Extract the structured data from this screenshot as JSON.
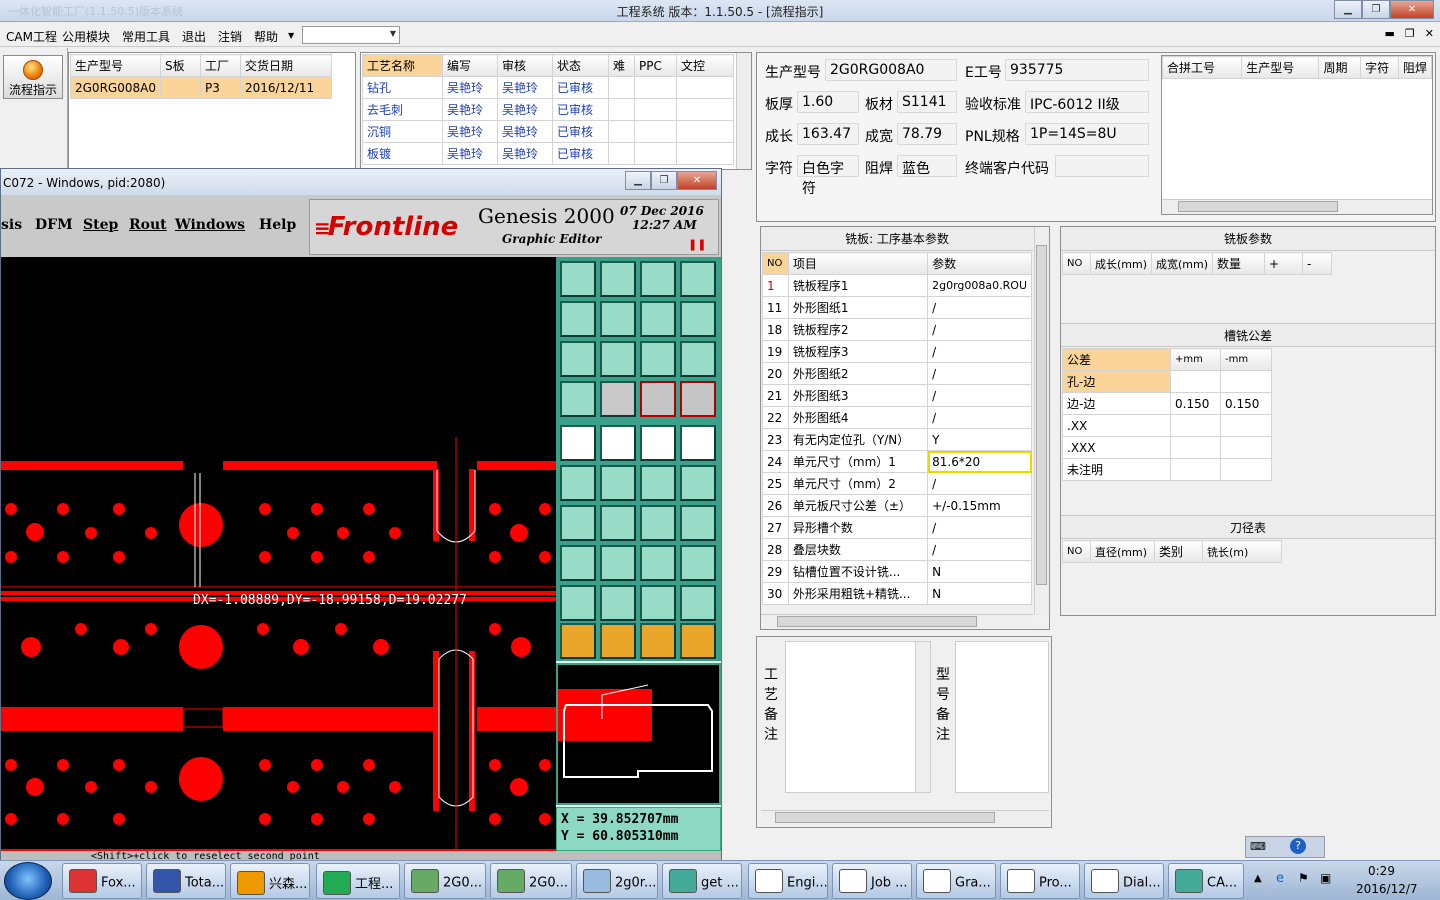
{
  "window": {
    "title": "工程系统  版本：1.1.50.5 - [流程指示]",
    "ghost": "一体化智能工厂(1.1.50.5)版本系统"
  },
  "menu": [
    "CAM工程",
    "公用模块",
    "常用工具",
    "退出",
    "注销",
    "帮助"
  ],
  "flow_button": "流程指示",
  "order_table": {
    "headers": [
      "生产型号",
      "S板",
      "工厂",
      "交货日期"
    ],
    "row": [
      "2G0RG008A0",
      "",
      "P3",
      "2016/12/11"
    ]
  },
  "process_table": {
    "headers": [
      "工艺名称",
      "编写",
      "审核",
      "状态",
      "难",
      "PPC",
      "文控"
    ],
    "rows": [
      [
        "钻孔",
        "吴艳玲",
        "吴艳玲",
        "已审核"
      ],
      [
        "去毛刺",
        "吴艳玲",
        "吴艳玲",
        "已审核"
      ],
      [
        "沉铜",
        "吴艳玲",
        "吴艳玲",
        "已审核"
      ],
      [
        "板镀",
        "吴艳玲",
        "吴艳玲",
        "已审核"
      ]
    ]
  },
  "genesis": {
    "title": "C072 - Windows, pid:2080)",
    "menu": [
      "sis",
      "DFM",
      "Step",
      "Rout",
      "Windows",
      "Help"
    ],
    "brand": "Frontline",
    "product": "Genesis 2000",
    "date": "07 Dec 2016",
    "time": "12:27 AM",
    "subtitle": "Graphic Editor",
    "measure": "DX=-1.08889,DY=-18.99158,D=19.02277",
    "x": "X =  39.852707mm",
    "y": "Y =  60.805310mm",
    "status": "<Shift>+click to reselect second point"
  },
  "info": {
    "fields": [
      {
        "label": "生产型号",
        "value": "2G0RG008A0"
      },
      {
        "label": "E工号",
        "value": "935775"
      },
      {
        "label": "板厚",
        "value": "1.60"
      },
      {
        "label": "板材",
        "value": "S1141"
      },
      {
        "label": "验收标准",
        "value": "IPC-6012 II级"
      },
      {
        "label": "成长",
        "value": "163.47"
      },
      {
        "label": "成宽",
        "value": "78.79"
      },
      {
        "label": "PNL规格",
        "value": "1P=14S=8U"
      },
      {
        "label": "字符",
        "value": "白色字符"
      },
      {
        "label": "阻焊",
        "value": "蓝色"
      },
      {
        "label": "终端客户代码",
        "value": ""
      }
    ]
  },
  "merge_table": {
    "headers": [
      "合拼工号",
      "生产型号",
      "周期",
      "字符",
      "阻焊"
    ]
  },
  "params": {
    "title": "铣板: 工序基本参数",
    "headers": [
      "NO",
      "项目",
      "参数"
    ],
    "rows": [
      [
        "1",
        "铣板程序1",
        "2g0rg008a0.ROU"
      ],
      [
        "11",
        "外形图纸1",
        "/"
      ],
      [
        "18",
        "铣板程序2",
        "/"
      ],
      [
        "19",
        "铣板程序3",
        "/"
      ],
      [
        "20",
        "外形图纸2",
        "/"
      ],
      [
        "21",
        "外形图纸3",
        "/"
      ],
      [
        "22",
        "外形图纸4",
        "/"
      ],
      [
        "23",
        "有无内定位孔（Y/N）",
        "Y"
      ],
      [
        "24",
        "单元尺寸（mm）1",
        "81.6*20"
      ],
      [
        "25",
        "单元尺寸（mm）2",
        "/"
      ],
      [
        "26",
        "单元板尺寸公差（±）",
        "+/-0.15mm"
      ],
      [
        "27",
        "异形槽个数",
        "/"
      ],
      [
        "28",
        "叠层块数",
        "/"
      ],
      [
        "29",
        "钻槽位置不设计铣...",
        "N"
      ],
      [
        "30",
        "外形采用粗铣+精铣...",
        "N"
      ]
    ]
  },
  "mill_params": {
    "title": "铣板参数",
    "headers": [
      "NO",
      "成长(mm)",
      "成宽(mm)",
      "数量",
      "+",
      "-"
    ]
  },
  "slot_tol": {
    "title": "槽铣公差",
    "headers": [
      "公差",
      "+mm",
      "-mm"
    ],
    "rows": [
      [
        "孔-边",
        "",
        ""
      ],
      [
        "边-边",
        "0.150",
        "0.150"
      ],
      [
        ".XX",
        "",
        ""
      ],
      [
        ".XXX",
        "",
        ""
      ],
      [
        "未注明",
        "",
        ""
      ]
    ]
  },
  "tools": {
    "title": "刀径表",
    "headers": [
      "NO",
      "直径(mm)",
      "类别",
      "铣长(m)"
    ]
  },
  "notes": {
    "left": [
      "工",
      "艺",
      "备",
      "注"
    ],
    "right": [
      "型",
      "号",
      "备",
      "注"
    ]
  },
  "taskbar": {
    "items": [
      "Fox...",
      "Tota...",
      "兴森...",
      "工程...",
      "2G0...",
      "2G0...",
      "2g0r...",
      "get ...",
      "Engi...",
      "Job ...",
      "Gra...",
      "Pro...",
      "Dial...",
      "CA..."
    ],
    "time": "0:29",
    "date": "2016/12/7"
  }
}
